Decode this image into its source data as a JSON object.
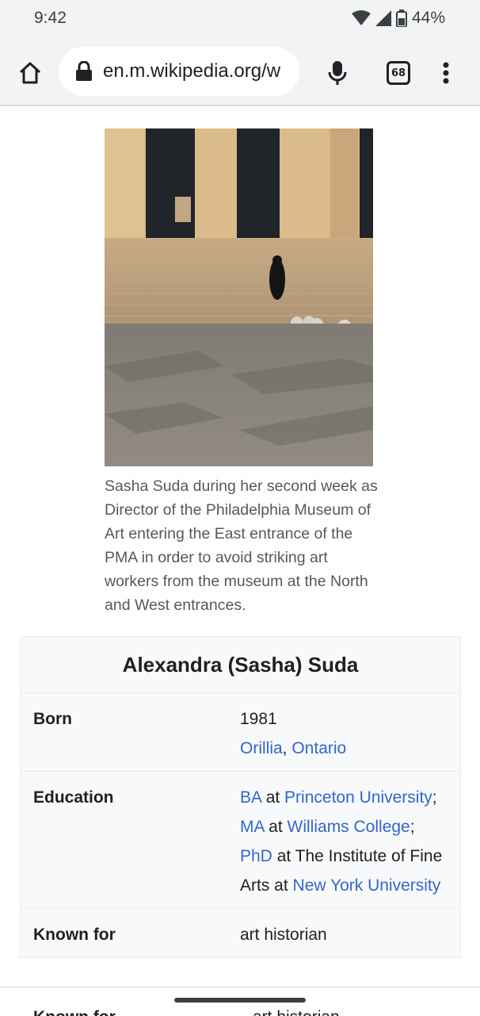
{
  "status_bar": {
    "time": "9:42",
    "battery_percent": "44%",
    "icons": [
      "wifi-icon",
      "signal-icon",
      "battery-icon"
    ]
  },
  "browser": {
    "url": "en.m.wikipedia.org/w",
    "tab_count": "68",
    "icons": [
      "home-icon",
      "lock-icon",
      "mic-icon",
      "tabs-icon",
      "more-vert-icon"
    ]
  },
  "article": {
    "image_caption": "Sasha Suda during her second week as Director of the Philadelphia Museum of Art entering the East entrance of the PMA in order to avoid striking art workers from the museum at the North and West entrances."
  },
  "infobox": {
    "title": "Alexandra (Sasha) Suda",
    "born_label": "Born",
    "born_year": "1981",
    "born_city": "Orillia",
    "born_sep": ", ",
    "born_province": "Ontario",
    "education_label": "Education",
    "edu_ba": "BA",
    "edu_at1": " at ",
    "edu_princeton": "Princeton University",
    "edu_sep1": "; ",
    "edu_ma": "MA",
    "edu_at2": " at ",
    "edu_williams": "Williams College",
    "edu_sep2": "; ",
    "edu_phd": "PhD",
    "edu_at3": " at The Institute of Fine Arts at ",
    "edu_nyu": "New York University",
    "known_for_label": "Known for",
    "known_for_value": "art historian"
  },
  "colors": {
    "link": "#3366cc",
    "chrome_bg": "#f1f3f4",
    "infobox_bg": "#f8f9fa"
  }
}
